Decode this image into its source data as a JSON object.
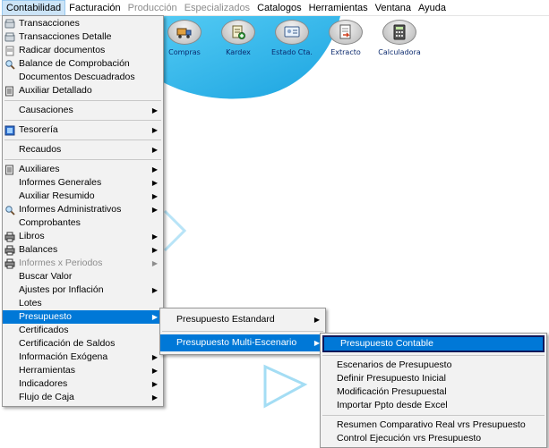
{
  "menubar": [
    {
      "label": "Contabilidad",
      "state": "active"
    },
    {
      "label": "Facturación",
      "state": "normal"
    },
    {
      "label": "Producción",
      "state": "disabled"
    },
    {
      "label": "Especializados",
      "state": "disabled"
    },
    {
      "label": "Catalogos",
      "state": "normal"
    },
    {
      "label": "Herramientas",
      "state": "normal"
    },
    {
      "label": "Ventana",
      "state": "normal"
    },
    {
      "label": "Ayuda",
      "state": "normal"
    }
  ],
  "toolbar": [
    {
      "label": "Compras",
      "icon": "truck-icon"
    },
    {
      "label": "Kardex",
      "icon": "kardex-icon"
    },
    {
      "label": "Estado Cta.",
      "icon": "id-card-icon"
    },
    {
      "label": "Extracto",
      "icon": "document-arrow-icon"
    },
    {
      "label": "Calculadora",
      "icon": "calculator-icon"
    }
  ],
  "contabilidad_menu": {
    "group1": [
      {
        "label": "Transacciones",
        "icon": "transactions-icon"
      },
      {
        "label": "Transacciones Detalle",
        "icon": "transactions-detail-icon"
      },
      {
        "label": "Radicar documentos",
        "icon": "file-icon"
      },
      {
        "label": "Balance de Comprobación",
        "icon": "magnifier-icon"
      },
      {
        "label": "Documentos Descuadrados",
        "icon": ""
      },
      {
        "label": "Auxiliar Detallado",
        "icon": "ledger-icon"
      }
    ],
    "group2": [
      {
        "label": "Causaciones",
        "submenu": true
      }
    ],
    "group3": [
      {
        "label": "Tesorería",
        "submenu": true,
        "icon": "treasury-icon"
      }
    ],
    "group4": [
      {
        "label": "Recaudos",
        "submenu": true
      }
    ],
    "group5": [
      {
        "label": "Auxiliares",
        "submenu": true,
        "icon": "ledger-icon"
      },
      {
        "label": "Informes Generales",
        "submenu": true
      },
      {
        "label": "Auxiliar Resumido",
        "submenu": true
      },
      {
        "label": "Informes Administrativos",
        "submenu": true,
        "icon": "magnifier-icon"
      },
      {
        "label": "Comprobantes"
      },
      {
        "label": "Libros",
        "submenu": true,
        "icon": "printer-icon"
      },
      {
        "label": "Balances",
        "submenu": true,
        "icon": "printer-icon"
      },
      {
        "label": "Informes x Periodos",
        "submenu": true,
        "disabled": true,
        "icon": "printer-icon"
      },
      {
        "label": "Buscar Valor"
      },
      {
        "label": "Ajustes por Inflación",
        "submenu": true
      },
      {
        "label": "Lotes"
      },
      {
        "label": "Presupuesto",
        "submenu": true,
        "highlighted": true
      },
      {
        "label": "Certificados"
      },
      {
        "label": "Certificación de Saldos"
      },
      {
        "label": "Información Exógena",
        "submenu": true
      },
      {
        "label": "Herramientas",
        "submenu": true
      },
      {
        "label": "Indicadores",
        "submenu": true
      },
      {
        "label": "Flujo de Caja",
        "submenu": true
      }
    ]
  },
  "presupuesto_menu": [
    {
      "label": "Presupuesto  Estandard",
      "submenu": true
    },
    {
      "label": "Presupuesto Multi-Escenario",
      "submenu": true,
      "highlighted": true
    }
  ],
  "multiescenario_menu": {
    "group1": [
      {
        "label": "Presupuesto Contable",
        "highlighted": true
      }
    ],
    "group2": [
      {
        "label": "Escenarios de Presupuesto"
      },
      {
        "label": "Definir Presupuesto Inicial"
      },
      {
        "label": "Modificación Presupuestal"
      },
      {
        "label": "Importar Ppto desde Excel"
      }
    ],
    "group3": [
      {
        "label": "Resumen Comparativo  Real vrs Presupuesto"
      },
      {
        "label": "Control Ejecución vrs Presupuesto"
      }
    ]
  },
  "colors": {
    "highlight": "#0078d7",
    "splash_blue": "#2fb6ea",
    "menu_bg": "#f2f2f2"
  }
}
